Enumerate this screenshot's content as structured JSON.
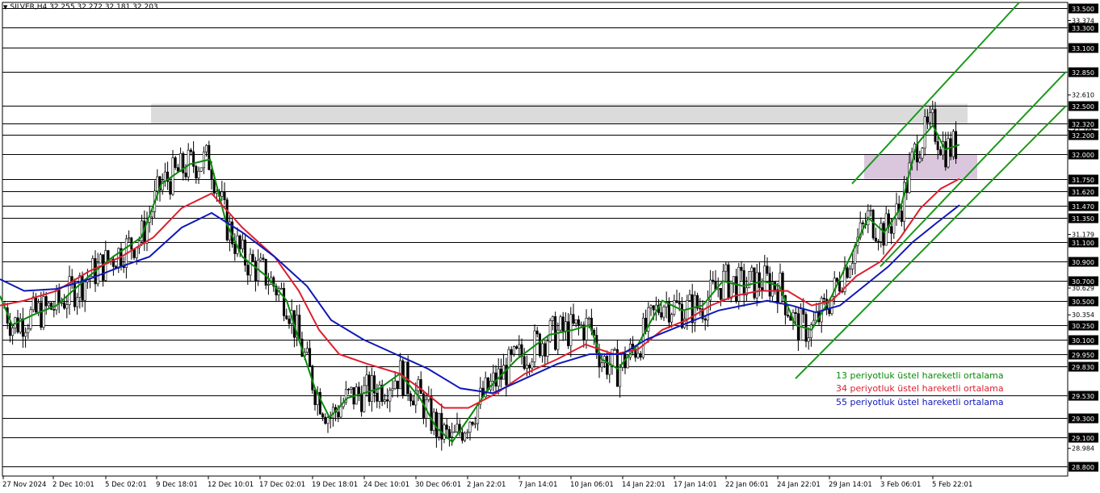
{
  "header": {
    "symbol_timeframe": "SILVER,H4",
    "ohlc": "32.255 32.272 32.181 32.203"
  },
  "colors": {
    "ema13": "#0a8a0a",
    "ema34": "#dd1f2f",
    "ema55": "#1018b8",
    "channel": "#1a9a1a",
    "resistance_zone": "#d9d9d9",
    "support_zone": "#d8c4dc",
    "candle": "#000000"
  },
  "chart_data": {
    "type": "candlestick",
    "instrument": "SILVER",
    "timeframe": "H4",
    "ylim": [
      28.7,
      33.56
    ],
    "price_levels": [
      "33.500",
      "33.300",
      "33.100",
      "32.850",
      "32.500",
      "32.320",
      "32.200",
      "32.000",
      "31.750",
      "31.620",
      "31.470",
      "31.350",
      "31.100",
      "30.900",
      "30.700",
      "30.500",
      "30.250",
      "30.100",
      "29.950",
      "29.830",
      "29.530",
      "29.300",
      "29.100",
      "28.800"
    ],
    "minor_ticks": [
      "33.374",
      "32.610",
      "32.246",
      "31.179",
      "30.629",
      "30.354",
      "28.984"
    ],
    "x_labels": [
      "27 Nov 2024",
      "2 Dec 10:01",
      "5 Dec 02:01",
      "9 Dec 18:01",
      "12 Dec 10:01",
      "17 Dec 02:01",
      "19 Dec 18:01",
      "24 Dec 10:01",
      "30 Dec 06:01",
      "2 Jan 22:01",
      "7 Jan 14:01",
      "10 Jan 06:01",
      "14 Jan 22:01",
      "17 Jan 14:01",
      "22 Jan 06:01",
      "24 Jan 22:01",
      "29 Jan 14:01",
      "3 Feb 06:01",
      "5 Feb 22:01"
    ],
    "series": [
      {
        "name": "13 periyotluk üstel hareketli ortalama",
        "color": "#0a8a0a",
        "points": [
          [
            0,
            30.55
          ],
          [
            15,
            30.25
          ],
          [
            40,
            30.35
          ],
          [
            70,
            30.45
          ],
          [
            110,
            30.75
          ],
          [
            140,
            30.95
          ],
          [
            175,
            31.15
          ],
          [
            200,
            31.7
          ],
          [
            235,
            31.9
          ],
          [
            260,
            31.95
          ],
          [
            280,
            31.3
          ],
          [
            300,
            30.95
          ],
          [
            330,
            30.75
          ],
          [
            355,
            30.5
          ],
          [
            370,
            30.1
          ],
          [
            390,
            29.6
          ],
          [
            408,
            29.3
          ],
          [
            430,
            29.5
          ],
          [
            470,
            29.6
          ],
          [
            495,
            29.75
          ],
          [
            520,
            29.5
          ],
          [
            540,
            29.2
          ],
          [
            560,
            29.05
          ],
          [
            585,
            29.35
          ],
          [
            605,
            29.6
          ],
          [
            640,
            29.9
          ],
          [
            680,
            30.15
          ],
          [
            710,
            30.2
          ],
          [
            730,
            30.25
          ],
          [
            745,
            29.9
          ],
          [
            765,
            29.8
          ],
          [
            790,
            30.05
          ],
          [
            820,
            30.5
          ],
          [
            845,
            30.4
          ],
          [
            870,
            30.45
          ],
          [
            895,
            30.7
          ],
          [
            920,
            30.65
          ],
          [
            945,
            30.7
          ],
          [
            965,
            30.65
          ],
          [
            985,
            30.25
          ],
          [
            1005,
            30.2
          ],
          [
            1030,
            30.55
          ],
          [
            1050,
            30.9
          ],
          [
            1075,
            31.35
          ],
          [
            1095,
            31.2
          ],
          [
            1115,
            31.45
          ],
          [
            1135,
            32.1
          ],
          [
            1155,
            32.3
          ],
          [
            1170,
            32.05
          ],
          [
            1188,
            32.1
          ]
        ]
      },
      {
        "name": "34 periyotluk üstel hareketli ortalama",
        "color": "#dd1f2f",
        "points": [
          [
            0,
            30.45
          ],
          [
            30,
            30.5
          ],
          [
            70,
            30.6
          ],
          [
            110,
            30.8
          ],
          [
            150,
            30.95
          ],
          [
            190,
            31.15
          ],
          [
            225,
            31.45
          ],
          [
            262,
            31.6
          ],
          [
            300,
            31.25
          ],
          [
            340,
            30.95
          ],
          [
            370,
            30.6
          ],
          [
            395,
            30.2
          ],
          [
            420,
            29.95
          ],
          [
            455,
            29.85
          ],
          [
            495,
            29.75
          ],
          [
            520,
            29.6
          ],
          [
            550,
            29.4
          ],
          [
            580,
            29.4
          ],
          [
            615,
            29.55
          ],
          [
            650,
            29.75
          ],
          [
            690,
            29.9
          ],
          [
            725,
            30.05
          ],
          [
            760,
            29.95
          ],
          [
            790,
            30.0
          ],
          [
            820,
            30.2
          ],
          [
            850,
            30.3
          ],
          [
            880,
            30.45
          ],
          [
            910,
            30.55
          ],
          [
            940,
            30.6
          ],
          [
            975,
            30.6
          ],
          [
            1005,
            30.45
          ],
          [
            1030,
            30.5
          ],
          [
            1060,
            30.75
          ],
          [
            1090,
            30.9
          ],
          [
            1115,
            31.15
          ],
          [
            1140,
            31.45
          ],
          [
            1165,
            31.65
          ],
          [
            1188,
            31.75
          ]
        ]
      },
      {
        "name": "55 periyotluk üstel hareketli ortalama",
        "color": "#1018b8",
        "points": [
          [
            0,
            30.72
          ],
          [
            30,
            30.6
          ],
          [
            70,
            30.62
          ],
          [
            110,
            30.72
          ],
          [
            150,
            30.85
          ],
          [
            185,
            30.95
          ],
          [
            225,
            31.25
          ],
          [
            262,
            31.4
          ],
          [
            300,
            31.2
          ],
          [
            340,
            30.95
          ],
          [
            380,
            30.65
          ],
          [
            410,
            30.3
          ],
          [
            450,
            30.1
          ],
          [
            490,
            29.95
          ],
          [
            530,
            29.8
          ],
          [
            570,
            29.6
          ],
          [
            610,
            29.55
          ],
          [
            650,
            29.7
          ],
          [
            690,
            29.85
          ],
          [
            730,
            29.95
          ],
          [
            770,
            29.95
          ],
          [
            800,
            30.1
          ],
          [
            830,
            30.2
          ],
          [
            860,
            30.3
          ],
          [
            890,
            30.4
          ],
          [
            920,
            30.45
          ],
          [
            950,
            30.5
          ],
          [
            980,
            30.45
          ],
          [
            1010,
            30.38
          ],
          [
            1040,
            30.45
          ],
          [
            1070,
            30.65
          ],
          [
            1100,
            30.85
          ],
          [
            1130,
            31.1
          ],
          [
            1160,
            31.3
          ],
          [
            1188,
            31.48
          ]
        ]
      }
    ],
    "channel_lines": [
      {
        "name": "upper",
        "from": [
          1055,
          31.7
        ],
        "to": [
          1262,
          33.56
        ]
      },
      {
        "name": "middle",
        "from": [
          1090,
          30.85
        ],
        "to": [
          1320,
          32.85
        ]
      },
      {
        "name": "lower",
        "from": [
          985,
          29.7
        ],
        "to": [
          1320,
          32.5
        ]
      }
    ],
    "zones": [
      {
        "name": "resistance",
        "x": [
          187,
          1198
        ],
        "y": [
          32.32,
          32.52
        ],
        "color": "#d9d9d9"
      },
      {
        "name": "support",
        "x": [
          1070,
          1210
        ],
        "y": [
          31.75,
          32.0
        ],
        "color": "#d8c4dc"
      }
    ],
    "legend": [
      "13 periyotluk üstel hareketli ortalama",
      "34 periyotluk üstel hareketli ortalama",
      "55 periyotluk üstel hareketli ortalama"
    ]
  }
}
